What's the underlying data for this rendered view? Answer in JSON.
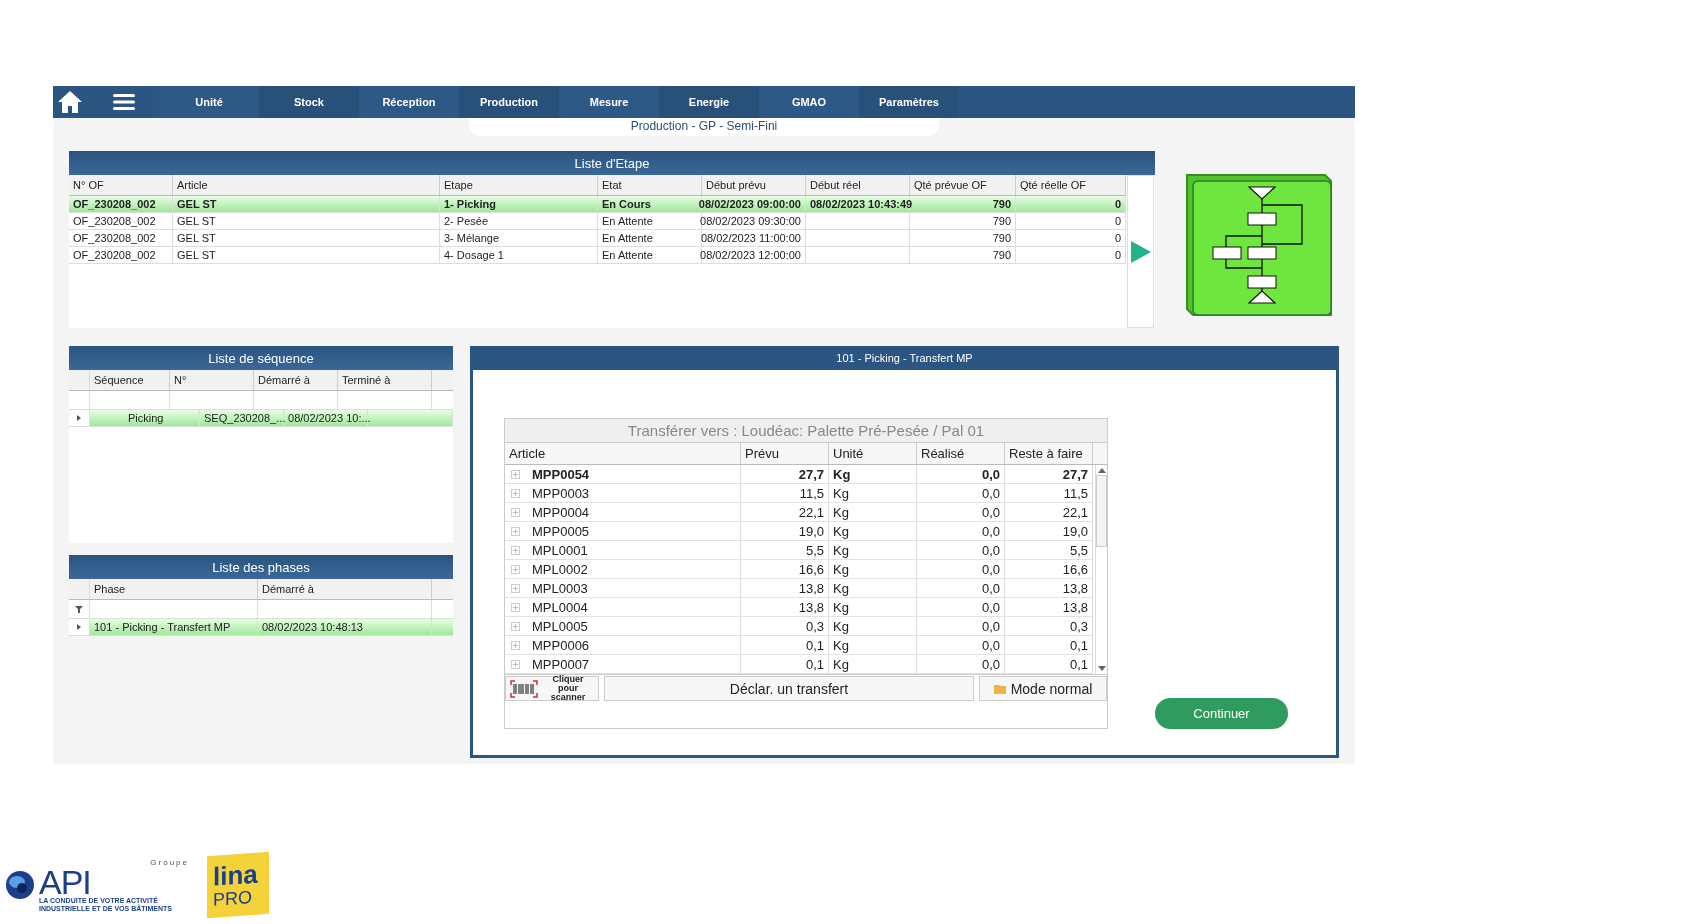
{
  "nav": {
    "items": [
      {
        "label": "Unité"
      },
      {
        "label": "Stock"
      },
      {
        "label": "Réception"
      },
      {
        "label": "Production"
      },
      {
        "label": "Mesure"
      },
      {
        "label": "Energie"
      },
      {
        "label": "GMAO"
      },
      {
        "label": "Paramètres"
      }
    ]
  },
  "subtitle": "Production - GP - Semi-Fini",
  "steps": {
    "title": "Liste d'Etape",
    "columns": [
      "N° OF",
      "Article",
      "Etape",
      "Etat",
      "Début prévu",
      "Début réel",
      "Qté prévue OF",
      "Qté réelle OF"
    ],
    "rows": [
      {
        "selected": true,
        "cells": [
          "OF_230208_002",
          "GEL ST",
          "1- Picking",
          "En Cours",
          "08/02/2023 09:00:00",
          "08/02/2023 10:43:49",
          "790",
          "0"
        ]
      },
      {
        "selected": false,
        "cells": [
          "OF_230208_002",
          "GEL ST",
          "2- Pesée",
          "En Attente",
          "08/02/2023 09:30:00",
          "",
          "790",
          "0"
        ]
      },
      {
        "selected": false,
        "cells": [
          "OF_230208_002",
          "GEL ST",
          "3- Mélange",
          "En Attente",
          "08/02/2023 11:00:00",
          "",
          "790",
          "0"
        ]
      },
      {
        "selected": false,
        "cells": [
          "OF_230208_002",
          "GEL ST",
          "4- Dosage 1",
          "En Attente",
          "08/02/2023 12:00:00",
          "",
          "790",
          "0"
        ]
      }
    ]
  },
  "sequence": {
    "title": "Liste de séquence",
    "columns": [
      "Séquence",
      "N°",
      "Démarré à",
      "Terminé à"
    ],
    "rows": [
      {
        "selected": true,
        "cells": [
          "Picking",
          "SEQ_230208_...",
          "08/02/2023 10:...",
          ""
        ]
      }
    ]
  },
  "phases": {
    "title": "Liste des phases",
    "columns": [
      "Phase",
      "Démarré à"
    ],
    "rows": [
      {
        "selected": true,
        "cells": [
          "101 - Picking - Transfert MP",
          "08/02/2023 10:48:13"
        ]
      }
    ]
  },
  "transfer": {
    "title": "101 - Picking - Transfert MP",
    "destination": "Transférer vers : Loudéac: Palette Pré-Pesée / Pal 01",
    "columns": [
      "Article",
      "Prévu",
      "Unité",
      "Réalisé",
      "Reste à faire"
    ],
    "rows": [
      {
        "selected": true,
        "cells": [
          "MPP0054",
          "27,7",
          "Kg",
          "0,0",
          "27,7"
        ]
      },
      {
        "selected": false,
        "cells": [
          "MPP0003",
          "11,5",
          "Kg",
          "0,0",
          "11,5"
        ]
      },
      {
        "selected": false,
        "cells": [
          "MPP0004",
          "22,1",
          "Kg",
          "0,0",
          "22,1"
        ]
      },
      {
        "selected": false,
        "cells": [
          "MPP0005",
          "19,0",
          "Kg",
          "0,0",
          "19,0"
        ]
      },
      {
        "selected": false,
        "cells": [
          "MPL0001",
          "5,5",
          "Kg",
          "0,0",
          "5,5"
        ]
      },
      {
        "selected": false,
        "cells": [
          "MPL0002",
          "16,6",
          "Kg",
          "0,0",
          "16,6"
        ]
      },
      {
        "selected": false,
        "cells": [
          "MPL0003",
          "13,8",
          "Kg",
          "0,0",
          "13,8"
        ]
      },
      {
        "selected": false,
        "cells": [
          "MPL0004",
          "13,8",
          "Kg",
          "0,0",
          "13,8"
        ]
      },
      {
        "selected": false,
        "cells": [
          "MPL0005",
          "0,3",
          "Kg",
          "0,0",
          "0,3"
        ]
      },
      {
        "selected": false,
        "cells": [
          "MPP0006",
          "0,1",
          "Kg",
          "0,0",
          "0,1"
        ]
      },
      {
        "selected": false,
        "cells": [
          "MPP0007",
          "0,1",
          "Kg",
          "0,0",
          "0,1"
        ]
      }
    ],
    "scan_button": "Cliquer pour scanner",
    "declare_button": "Déclar. un transfert",
    "mode_button": "Mode normal"
  },
  "continue_button": "Continuer",
  "logos": {
    "api_group": "Groupe",
    "api": "API",
    "api_tagline": "LA CONDUITE DE VOTRE ACTIVITÉ INDUSTRIELLE ET DE VOS BÂTIMENTS",
    "lina": "lina",
    "pro": "PRO"
  }
}
